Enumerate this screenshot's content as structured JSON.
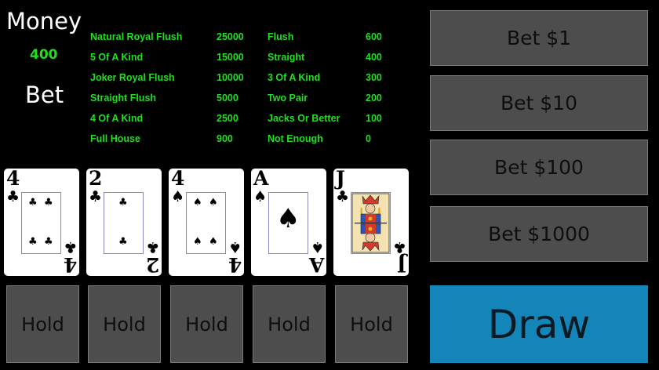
{
  "header": {
    "money_label": "Money",
    "money_value": "400",
    "bet_label": "Bet"
  },
  "paytable": {
    "left": [
      {
        "name": "Natural Royal Flush",
        "payout": "25000"
      },
      {
        "name": "5 Of A Kind",
        "payout": "15000"
      },
      {
        "name": "Joker Royal Flush",
        "payout": "10000"
      },
      {
        "name": "Straight Flush",
        "payout": "5000"
      },
      {
        "name": "4 Of A Kind",
        "payout": "2500"
      },
      {
        "name": "Full House",
        "payout": "900"
      }
    ],
    "right": [
      {
        "name": "Flush",
        "payout": "600"
      },
      {
        "name": "Straight",
        "payout": "400"
      },
      {
        "name": "3 Of A Kind",
        "payout": "300"
      },
      {
        "name": "Two Pair",
        "payout": "200"
      },
      {
        "name": "Jacks Or Better",
        "payout": "100"
      },
      {
        "name": "Not Enough",
        "payout": "0"
      }
    ]
  },
  "cards": [
    {
      "rank": "4",
      "suit": "♣"
    },
    {
      "rank": "2",
      "suit": "♣"
    },
    {
      "rank": "4",
      "suit": "♠"
    },
    {
      "rank": "A",
      "suit": "♠"
    },
    {
      "rank": "J",
      "suit": "♣"
    }
  ],
  "hold_label": "Hold",
  "bet_buttons": [
    "Bet $1",
    "Bet $10",
    "Bet $100",
    "Bet $1000"
  ],
  "draw_label": "Draw",
  "colors": {
    "text_green": "#22dd22",
    "button_gray": "#4d4d4d",
    "draw_blue": "#1485b8"
  }
}
